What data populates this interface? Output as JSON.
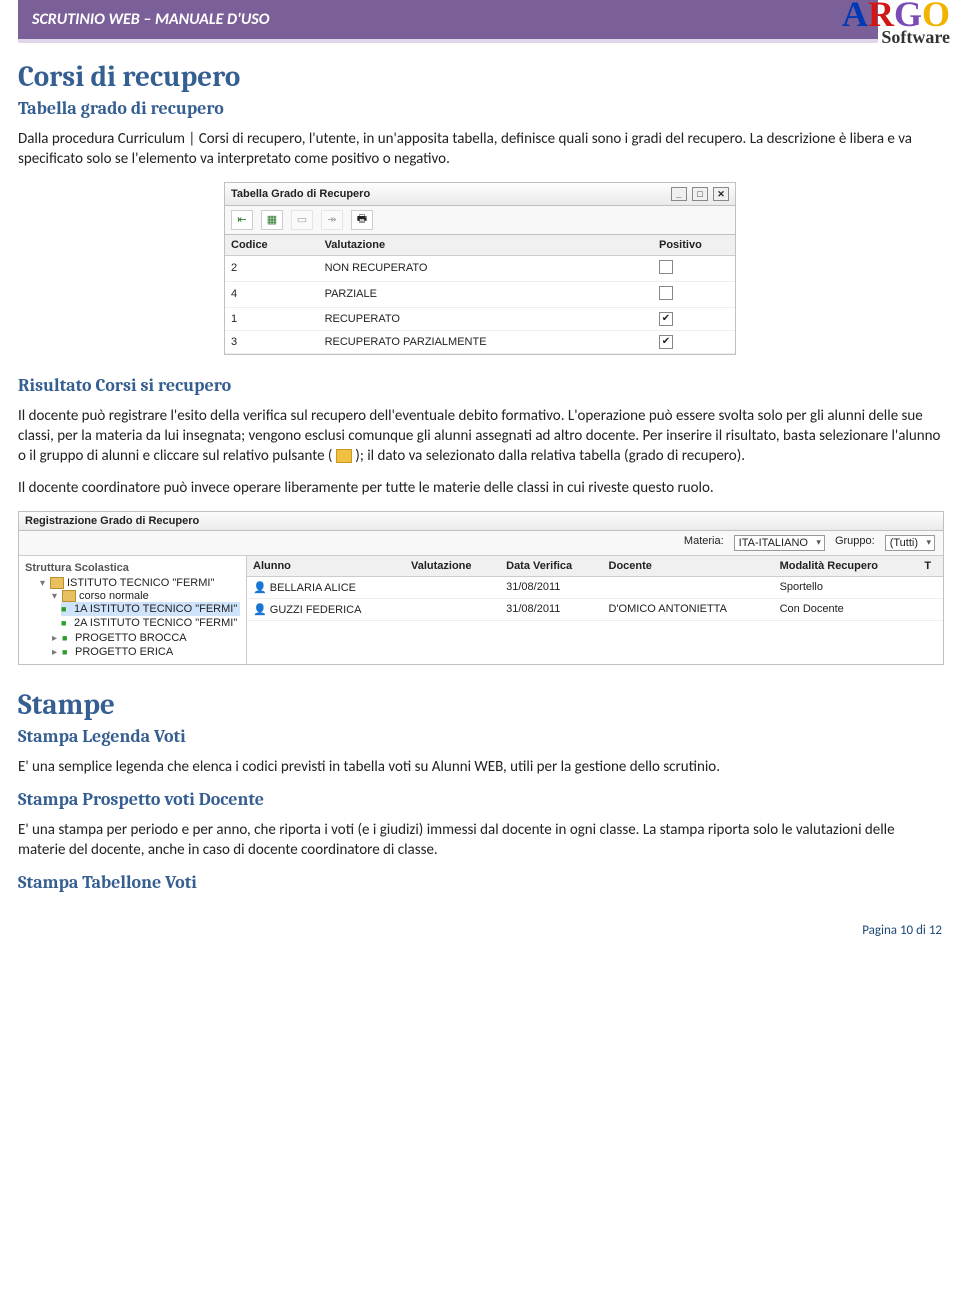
{
  "header": {
    "title": "SCRUTINIO WEB – MANUALE D'USO",
    "logo": {
      "letters": [
        "A",
        "R",
        "G",
        "O"
      ],
      "subtitle": "Software"
    }
  },
  "section1": {
    "heading": "Corsi di recupero",
    "sub1": {
      "title": "Tabella grado di recupero",
      "para": "Dalla procedura Curriculum | Corsi di recupero, l'utente, in un'apposita tabella, definisce quali sono i gradi del recupero. La descrizione è libera e va specificato solo se l'elemento va interpretato come positivo o negativo."
    },
    "win1": {
      "title": "Tabella Grado di Recupero",
      "cols": [
        "Codice",
        "Valutazione",
        "Positivo"
      ],
      "rows": [
        {
          "codice": "2",
          "val": "NON RECUPERATO",
          "pos": false
        },
        {
          "codice": "4",
          "val": "PARZIALE",
          "pos": false
        },
        {
          "codice": "1",
          "val": "RECUPERATO",
          "pos": true
        },
        {
          "codice": "3",
          "val": "RECUPERATO PARZIALMENTE",
          "pos": true
        }
      ]
    },
    "sub2": {
      "title": "Risultato Corsi si recupero",
      "para1a": "Il docente può registrare l'esito della verifica sul recupero dell'eventuale debito formativo. L'operazione può essere svolta solo per gli alunni delle sue classi, per la materia da lui insegnata; vengono esclusi comunque gli alunni assegnati ad altro docente. Per inserire il risultato, basta selezionare l'alunno o il gruppo di alunni e cliccare sul relativo pulsante (",
      "para1b": "); il dato va selezionato dalla relativa tabella (grado di recupero).",
      "para2": "Il docente coordinatore può invece operare liberamente per tutte le materie delle classi in cui riveste questo ruolo."
    },
    "win2": {
      "title": "Registrazione Grado di Recupero",
      "filter": {
        "materia_label": "Materia:",
        "materia_value": "ITA-ITALIANO",
        "gruppo_label": "Gruppo:",
        "gruppo_value": "(Tutti)"
      },
      "tree": {
        "title": "Struttura Scolastica",
        "root": "ISTITUTO TECNICO \"FERMI\"",
        "branch1": "corso normale",
        "leaf1": "1A ISTITUTO TECNICO \"FERMI\"",
        "leaf2": "2A ISTITUTO TECNICO \"FERMI\"",
        "branch2": "PROGETTO BROCCA",
        "branch3": "PROGETTO ERICA"
      },
      "list": {
        "cols": [
          "Alunno",
          "Valutazione",
          "Data Verifica",
          "Docente",
          "Modalità Recupero",
          "T"
        ],
        "rows": [
          {
            "alunno": "BELLARIA ALICE",
            "val": "",
            "data": "31/08/2011",
            "doc": "",
            "mod": "Sportello"
          },
          {
            "alunno": "GUZZI FEDERICA",
            "val": "",
            "data": "31/08/2011",
            "doc": "D'OMICO ANTONIETTA",
            "mod": "Con Docente"
          }
        ]
      }
    }
  },
  "section2": {
    "heading": "Stampe",
    "sub1": {
      "title": "Stampa Legenda Voti",
      "para": "E' una semplice legenda che elenca i codici previsti in tabella voti su Alunni WEB, utili per la gestione dello scrutinio."
    },
    "sub2": {
      "title": "Stampa Prospetto voti Docente",
      "para": "E' una stampa per periodo e per anno, che riporta i voti (e i giudizi) immessi dal docente in ogni classe. La stampa riporta solo le valutazioni delle materie del docente, anche in caso di docente coordinatore di classe."
    },
    "sub3": {
      "title": "Stampa Tabellone Voti"
    }
  },
  "footer": {
    "page_label": "Pagina 10 di 12"
  }
}
